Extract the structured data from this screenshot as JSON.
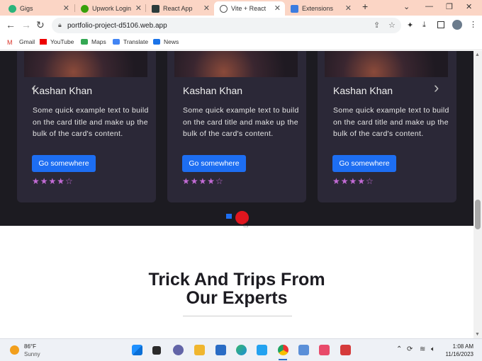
{
  "browser": {
    "tabs": [
      {
        "label": "Gigs",
        "color": "#2ab47b"
      },
      {
        "label": "Upwork Login",
        "color": "#37a00a"
      },
      {
        "label": "React App",
        "color": "#2b3b3b"
      },
      {
        "label": "Vite + React",
        "color": "#555555"
      },
      {
        "label": "Extensions",
        "color": "#3c7ce0"
      }
    ],
    "new_tab": "+",
    "url": "portfolio-project-d5106.web.app",
    "bookmarks": [
      "Gmail",
      "YouTube",
      "Maps",
      "Translate",
      "News"
    ]
  },
  "page": {
    "cards": [
      {
        "title": "Kashan Khan",
        "text": "Some quick example text to build on the card title and make up the bulk of the card's content.",
        "button": "Go somewhere",
        "rating": 4,
        "max_rating": 5
      },
      {
        "title": "Kashan Khan",
        "text": "Some quick example text to build on the card title and make up the bulk of the card's content.",
        "button": "Go somewhere",
        "rating": 4,
        "max_rating": 5
      },
      {
        "title": "Kashan Khan",
        "text": "Some quick example text to build on the card title and make up the bulk of the card's content.",
        "button": "Go somewhere",
        "rating": 4,
        "max_rating": 5
      }
    ],
    "prev_arrow": "‹",
    "next_arrow": "›",
    "heading_line1": "Trick And Trips From",
    "heading_line2": "Our Experts"
  },
  "taskbar": {
    "temperature": "86°F",
    "weather": "Sunny",
    "time": "1:08 AM",
    "date": "11/16/2023"
  },
  "colors": {
    "accent": "#1d6ef2",
    "star": "#c36bd6",
    "dark_bg": "#1c1b21",
    "card_bg": "#2b2837"
  }
}
